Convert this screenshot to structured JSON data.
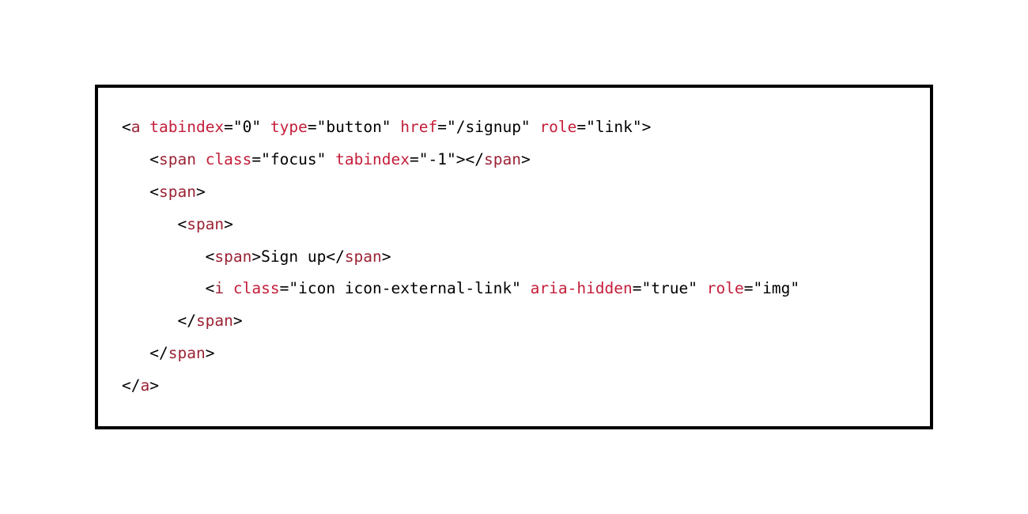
{
  "code": {
    "lines": [
      {
        "indent": "",
        "segments": [
          {
            "t": "punct",
            "v": "<"
          },
          {
            "t": "tag",
            "v": "a"
          },
          {
            "t": "space",
            "v": " "
          },
          {
            "t": "attr",
            "v": "tabindex"
          },
          {
            "t": "punct",
            "v": "="
          },
          {
            "t": "val",
            "v": "\"0\""
          },
          {
            "t": "space",
            "v": " "
          },
          {
            "t": "attr",
            "v": "type"
          },
          {
            "t": "punct",
            "v": "="
          },
          {
            "t": "val",
            "v": "\"button\""
          },
          {
            "t": "space",
            "v": " "
          },
          {
            "t": "attr",
            "v": "href"
          },
          {
            "t": "punct",
            "v": "="
          },
          {
            "t": "val",
            "v": "\"/signup\""
          },
          {
            "t": "space",
            "v": " "
          },
          {
            "t": "attr",
            "v": "role"
          },
          {
            "t": "punct",
            "v": "="
          },
          {
            "t": "val",
            "v": "\"link\""
          },
          {
            "t": "punct",
            "v": ">"
          }
        ]
      },
      {
        "indent": "   ",
        "segments": [
          {
            "t": "punct",
            "v": "<"
          },
          {
            "t": "tag",
            "v": "span"
          },
          {
            "t": "space",
            "v": " "
          },
          {
            "t": "attr",
            "v": "class"
          },
          {
            "t": "punct",
            "v": "="
          },
          {
            "t": "val",
            "v": "\"focus\""
          },
          {
            "t": "space",
            "v": " "
          },
          {
            "t": "attr",
            "v": "tabindex"
          },
          {
            "t": "punct",
            "v": "="
          },
          {
            "t": "val",
            "v": "\"-1\""
          },
          {
            "t": "punct",
            "v": ">"
          },
          {
            "t": "punct",
            "v": "</"
          },
          {
            "t": "tag",
            "v": "span"
          },
          {
            "t": "punct",
            "v": ">"
          }
        ]
      },
      {
        "indent": "   ",
        "segments": [
          {
            "t": "punct",
            "v": "<"
          },
          {
            "t": "tag",
            "v": "span"
          },
          {
            "t": "punct",
            "v": ">"
          }
        ]
      },
      {
        "indent": "      ",
        "segments": [
          {
            "t": "punct",
            "v": "<"
          },
          {
            "t": "tag",
            "v": "span"
          },
          {
            "t": "punct",
            "v": ">"
          }
        ]
      },
      {
        "indent": "         ",
        "segments": [
          {
            "t": "punct",
            "v": "<"
          },
          {
            "t": "tag",
            "v": "span"
          },
          {
            "t": "punct",
            "v": ">"
          },
          {
            "t": "text",
            "v": "Sign up"
          },
          {
            "t": "punct",
            "v": "</"
          },
          {
            "t": "tag",
            "v": "span"
          },
          {
            "t": "punct",
            "v": ">"
          }
        ]
      },
      {
        "indent": "         ",
        "segments": [
          {
            "t": "punct",
            "v": "<"
          },
          {
            "t": "tag",
            "v": "i"
          },
          {
            "t": "space",
            "v": " "
          },
          {
            "t": "attr",
            "v": "class"
          },
          {
            "t": "punct",
            "v": "="
          },
          {
            "t": "val",
            "v": "\"icon icon-external-link\""
          },
          {
            "t": "space",
            "v": " "
          },
          {
            "t": "attr",
            "v": "aria-hidden"
          },
          {
            "t": "punct",
            "v": "="
          },
          {
            "t": "val",
            "v": "\"true\""
          },
          {
            "t": "space",
            "v": " "
          },
          {
            "t": "attr",
            "v": "role"
          },
          {
            "t": "punct",
            "v": "="
          },
          {
            "t": "val",
            "v": "\"img\""
          }
        ]
      },
      {
        "indent": "      ",
        "segments": [
          {
            "t": "punct",
            "v": "</"
          },
          {
            "t": "tag",
            "v": "span"
          },
          {
            "t": "punct",
            "v": ">"
          }
        ]
      },
      {
        "indent": "   ",
        "segments": [
          {
            "t": "punct",
            "v": "</"
          },
          {
            "t": "tag",
            "v": "span"
          },
          {
            "t": "punct",
            "v": ">"
          }
        ]
      },
      {
        "indent": "",
        "segments": [
          {
            "t": "punct",
            "v": "</"
          },
          {
            "t": "tag",
            "v": "a"
          },
          {
            "t": "punct",
            "v": ">"
          }
        ]
      }
    ]
  }
}
